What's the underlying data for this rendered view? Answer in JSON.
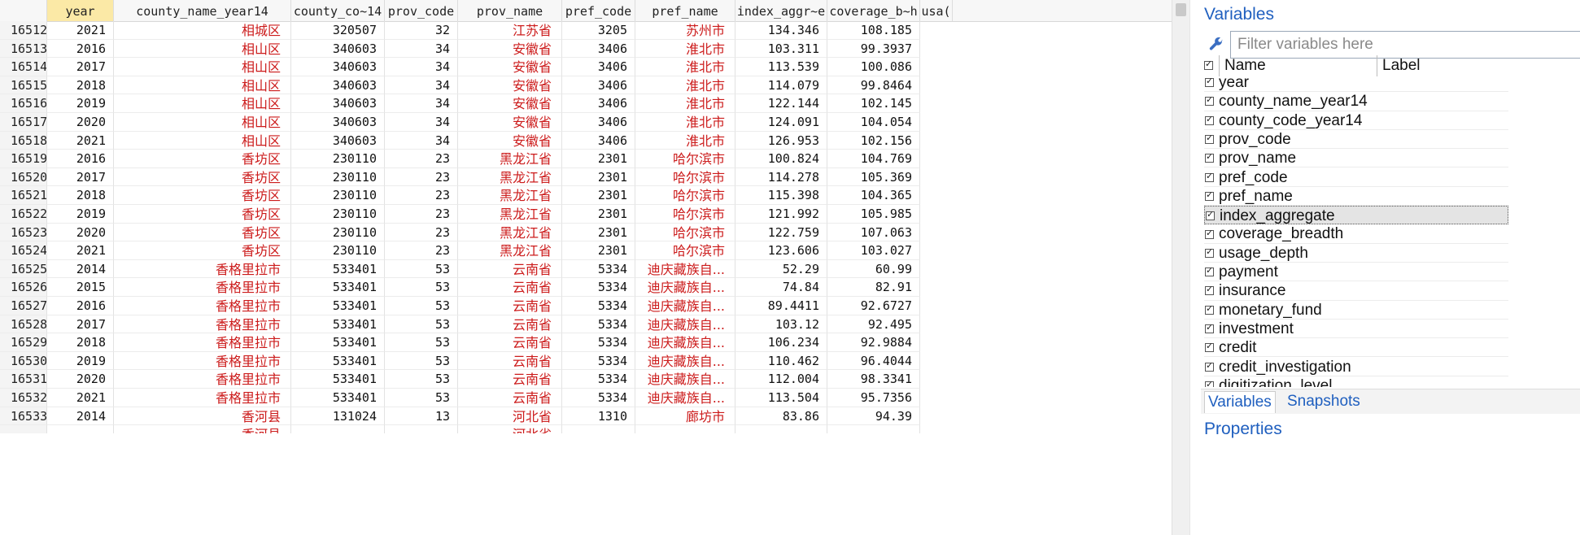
{
  "grid": {
    "columns": [
      "",
      "year",
      "county_name_year14",
      "county_co~14",
      "prov_code",
      "prov_name",
      "pref_code",
      "pref_name",
      "index_aggr~e",
      "coverage_b~h",
      "usa("
    ],
    "selected_column": "year",
    "rows": [
      [
        "16512",
        "2021",
        "相城区",
        "320507",
        "32",
        "江苏省",
        "3205",
        "苏州市",
        "134.346",
        "108.185"
      ],
      [
        "16513",
        "2016",
        "相山区",
        "340603",
        "34",
        "安徽省",
        "3406",
        "淮北市",
        "103.311",
        "99.3937"
      ],
      [
        "16514",
        "2017",
        "相山区",
        "340603",
        "34",
        "安徽省",
        "3406",
        "淮北市",
        "113.539",
        "100.086"
      ],
      [
        "16515",
        "2018",
        "相山区",
        "340603",
        "34",
        "安徽省",
        "3406",
        "淮北市",
        "114.079",
        "99.8464"
      ],
      [
        "16516",
        "2019",
        "相山区",
        "340603",
        "34",
        "安徽省",
        "3406",
        "淮北市",
        "122.144",
        "102.145"
      ],
      [
        "16517",
        "2020",
        "相山区",
        "340603",
        "34",
        "安徽省",
        "3406",
        "淮北市",
        "124.091",
        "104.054"
      ],
      [
        "16518",
        "2021",
        "相山区",
        "340603",
        "34",
        "安徽省",
        "3406",
        "淮北市",
        "126.953",
        "102.156"
      ],
      [
        "16519",
        "2016",
        "香坊区",
        "230110",
        "23",
        "黑龙江省",
        "2301",
        "哈尔滨市",
        "100.824",
        "104.769"
      ],
      [
        "16520",
        "2017",
        "香坊区",
        "230110",
        "23",
        "黑龙江省",
        "2301",
        "哈尔滨市",
        "114.278",
        "105.369"
      ],
      [
        "16521",
        "2018",
        "香坊区",
        "230110",
        "23",
        "黑龙江省",
        "2301",
        "哈尔滨市",
        "115.398",
        "104.365"
      ],
      [
        "16522",
        "2019",
        "香坊区",
        "230110",
        "23",
        "黑龙江省",
        "2301",
        "哈尔滨市",
        "121.992",
        "105.985"
      ],
      [
        "16523",
        "2020",
        "香坊区",
        "230110",
        "23",
        "黑龙江省",
        "2301",
        "哈尔滨市",
        "122.759",
        "107.063"
      ],
      [
        "16524",
        "2021",
        "香坊区",
        "230110",
        "23",
        "黑龙江省",
        "2301",
        "哈尔滨市",
        "123.606",
        "103.027"
      ],
      [
        "16525",
        "2014",
        "香格里拉市",
        "533401",
        "53",
        "云南省",
        "5334",
        "迪庆藏族自...",
        "52.29",
        "60.99"
      ],
      [
        "16526",
        "2015",
        "香格里拉市",
        "533401",
        "53",
        "云南省",
        "5334",
        "迪庆藏族自...",
        "74.84",
        "82.91"
      ],
      [
        "16527",
        "2016",
        "香格里拉市",
        "533401",
        "53",
        "云南省",
        "5334",
        "迪庆藏族自...",
        "89.4411",
        "92.6727"
      ],
      [
        "16528",
        "2017",
        "香格里拉市",
        "533401",
        "53",
        "云南省",
        "5334",
        "迪庆藏族自...",
        "103.12",
        "92.495"
      ],
      [
        "16529",
        "2018",
        "香格里拉市",
        "533401",
        "53",
        "云南省",
        "5334",
        "迪庆藏族自...",
        "106.234",
        "92.9884"
      ],
      [
        "16530",
        "2019",
        "香格里拉市",
        "533401",
        "53",
        "云南省",
        "5334",
        "迪庆藏族自...",
        "110.462",
        "96.4044"
      ],
      [
        "16531",
        "2020",
        "香格里拉市",
        "533401",
        "53",
        "云南省",
        "5334",
        "迪庆藏族自...",
        "112.004",
        "98.3341"
      ],
      [
        "16532",
        "2021",
        "香格里拉市",
        "533401",
        "53",
        "云南省",
        "5334",
        "迪庆藏族自...",
        "113.504",
        "95.7356"
      ],
      [
        "16533",
        "2014",
        "香河县",
        "131024",
        "13",
        "河北省",
        "1310",
        "廊坊市",
        "83.86",
        "94.39"
      ]
    ],
    "partial_row": [
      "",
      "",
      "香河县",
      "",
      "",
      "河北省",
      "",
      "",
      "",
      ""
    ]
  },
  "variables_panel": {
    "title": "Variables",
    "filter_placeholder": "Filter variables here",
    "col_name": "Name",
    "col_label": "Label",
    "selected": "index_aggregate",
    "items": [
      "year",
      "county_name_year14",
      "county_code_year14",
      "prov_code",
      "prov_name",
      "pref_code",
      "pref_name",
      "index_aggregate",
      "coverage_breadth",
      "usage_depth",
      "payment",
      "insurance",
      "monetary_fund",
      "investment",
      "credit",
      "credit_investigation",
      "digitization_level"
    ],
    "tabs": [
      "Variables",
      "Snapshots"
    ],
    "properties_title": "Properties"
  },
  "icons": {
    "filter": "wrench-icon",
    "checkbox": "checkbox-checked-icon"
  }
}
